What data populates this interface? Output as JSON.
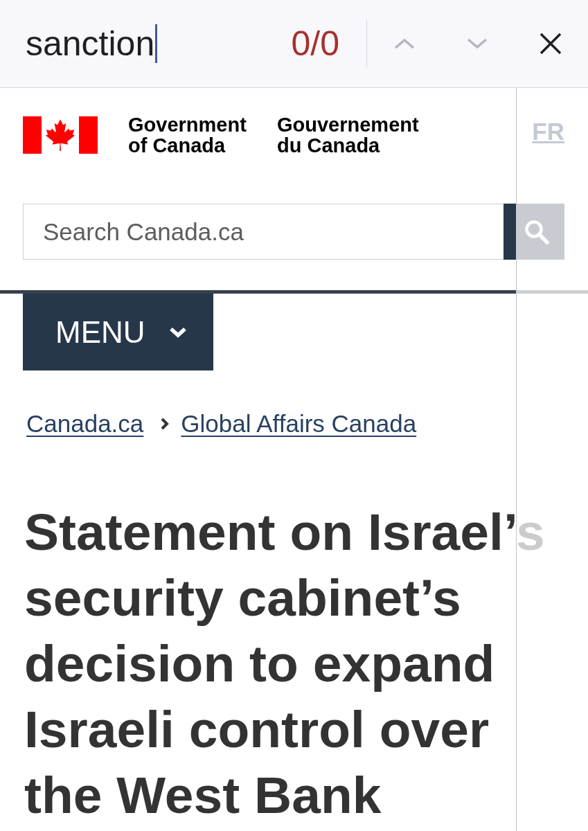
{
  "find_bar": {
    "query": "sanction",
    "match_count": "0/0",
    "previous_disabled": true,
    "next_disabled": true
  },
  "header": {
    "signature_english": "Government of Canada",
    "signature_french": "Gouvernement du Canada",
    "language_link": "FR"
  },
  "search": {
    "placeholder": "Search Canada.ca"
  },
  "menu_button": {
    "label": "MENU"
  },
  "breadcrumbs": [
    "Canada.ca",
    "Global Affairs Canada"
  ],
  "heading": "Statement on Israel’s security cabinet’s decision to expand Israeli control over the West Bank"
}
